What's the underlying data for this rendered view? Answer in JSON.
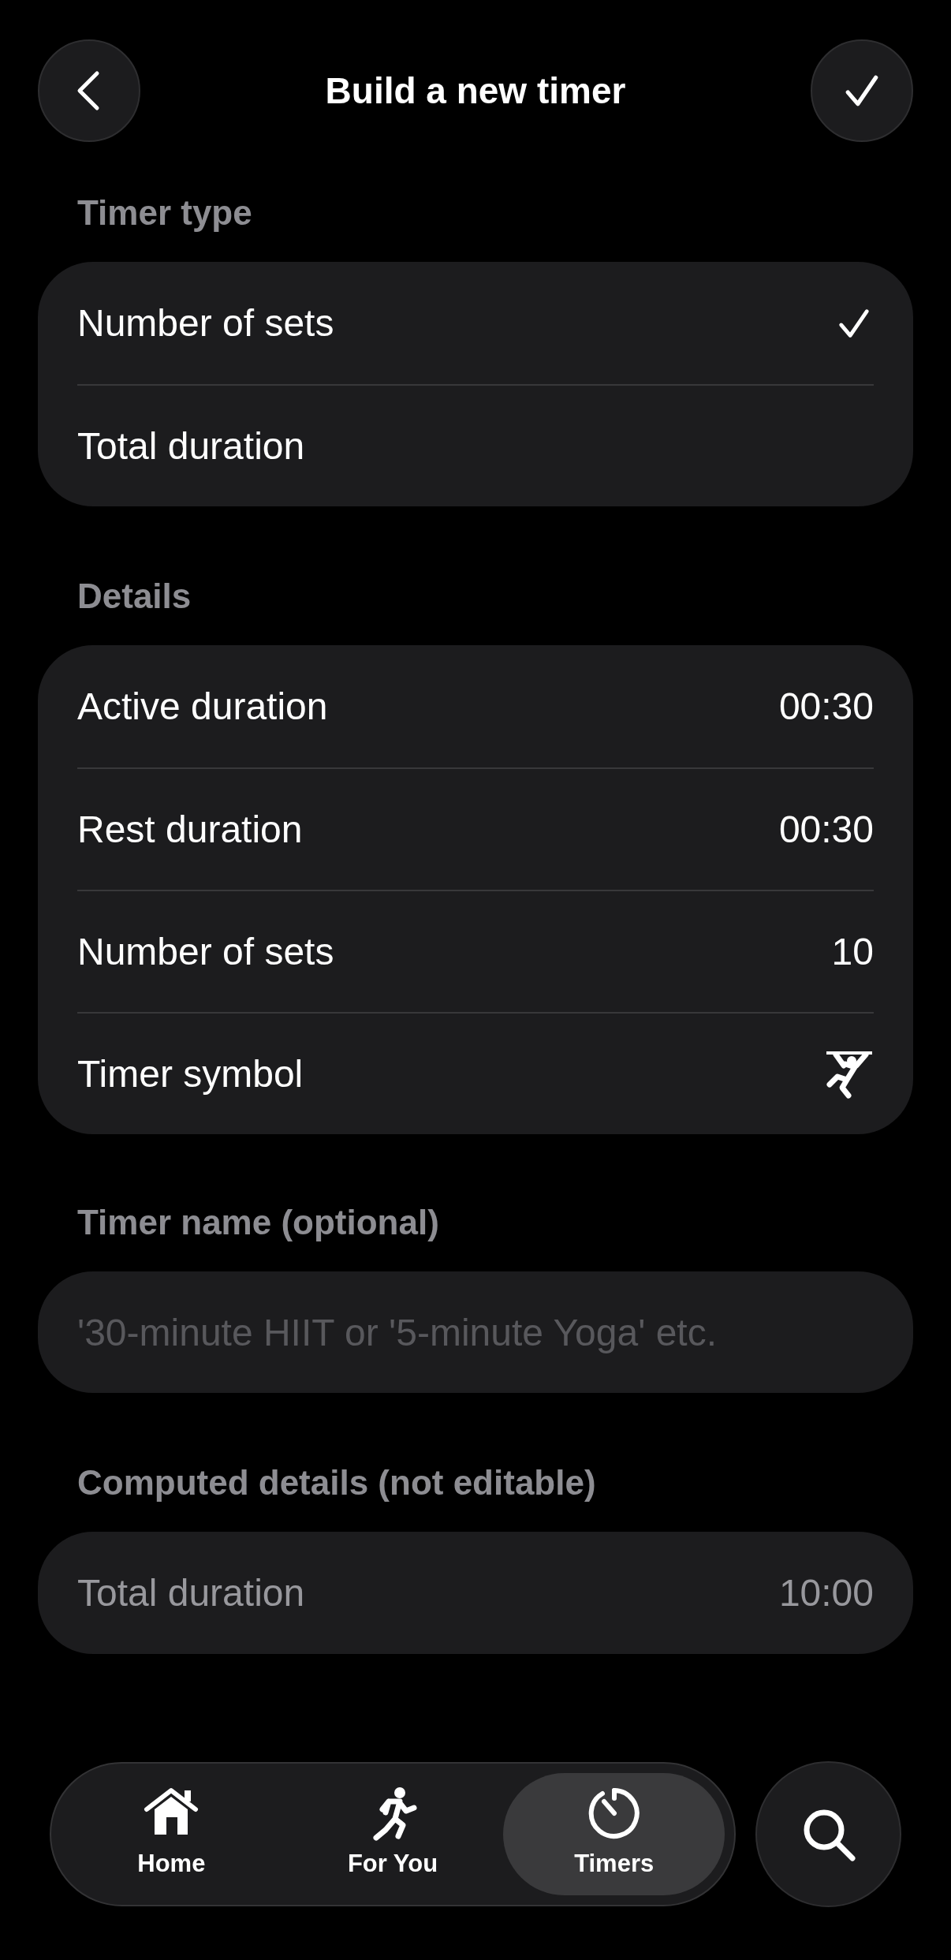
{
  "header": {
    "title": "Build a new timer"
  },
  "timer_type": {
    "label": "Timer type",
    "options": [
      {
        "label": "Number of sets",
        "selected": true
      },
      {
        "label": "Total duration",
        "selected": false
      }
    ]
  },
  "details": {
    "label": "Details",
    "rows": [
      {
        "kind": "value",
        "label": "Active duration",
        "value": "00:30"
      },
      {
        "kind": "value",
        "label": "Rest duration",
        "value": "00:30"
      },
      {
        "kind": "value",
        "label": "Number of sets",
        "value": "10"
      },
      {
        "kind": "symbol",
        "label": "Timer symbol"
      }
    ]
  },
  "timer_name": {
    "label": "Timer name (optional)",
    "placeholder": "'30-minute HIIT or '5-minute Yoga' etc."
  },
  "computed": {
    "label": "Computed details (not editable)",
    "rows": [
      {
        "label": "Total duration",
        "value": "10:00"
      }
    ]
  },
  "tab_bar": {
    "tabs": [
      {
        "label": "Home",
        "kind": "home",
        "selected": false
      },
      {
        "label": "For You",
        "kind": "runner",
        "selected": false
      },
      {
        "label": "Timers",
        "kind": "timer",
        "selected": true
      }
    ]
  }
}
